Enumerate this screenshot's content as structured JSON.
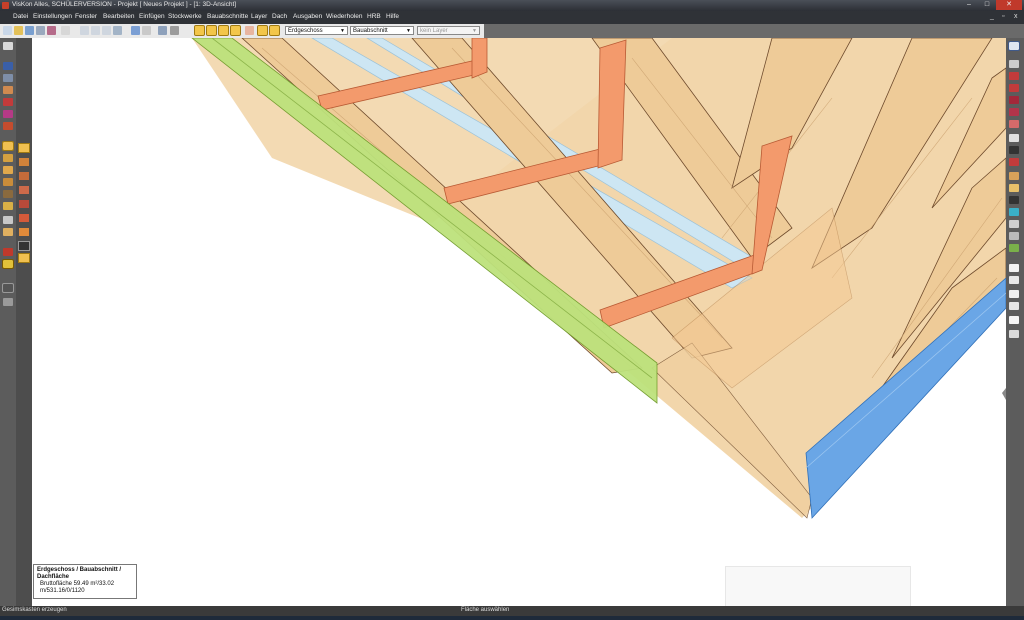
{
  "window": {
    "title": "VisKon Alles, SCHÜLERVERSION - Projekt [ Neues Projekt ] - [1: 3D-Ansicht]",
    "controls": [
      "–",
      "□",
      "✕"
    ]
  },
  "menu": {
    "items": [
      "Datei",
      "Einstellungen",
      "Fenster",
      "Bearbeiten",
      "Einfügen",
      "Stockwerke",
      "Bauabschnitte",
      "Layer",
      "Dach",
      "Ausgaben",
      "Wiederholen",
      "HRB",
      "Hilfe"
    ],
    "mdi_controls": [
      "_",
      "▫",
      "x"
    ]
  },
  "toolbar": {
    "floor_select": "Erdgeschoss",
    "section_select": "Bauabschnitt",
    "layer_select": "kein Layer"
  },
  "info": {
    "heading": "Erdgeschoss / Bauabschnitt / Dachfläche",
    "line1": "Bruttofläche 59.49 m²/33.02",
    "line2": "m/531.16/0/1120"
  },
  "status": {
    "left": "Gesimskasten erzeugen",
    "center": "Fläche auswählen"
  },
  "colors": {
    "wood": "#f1d3a6",
    "rafter_edge": "#6e4a2c",
    "collar_tie": "#f39a6c",
    "eaves_green": "#bde27c",
    "eaves_blue": "#6aa6e6",
    "batten_blue": "#cde6f3"
  },
  "icons": {
    "left_toolbar": [
      "cursor-icon",
      "roof-icon",
      "stack-icon",
      "wall-icon",
      "window-icon",
      "door-icon",
      "stair-icon",
      "column-icon",
      "slab-icon",
      "beam-icon",
      "dimension-icon",
      "text-icon",
      "hatch-icon",
      "line-icon",
      "arc-icon",
      "delete-icon",
      "measure-icon"
    ],
    "right_toolbar": [
      "3d-view-icon",
      "layer-icon",
      "eye-icon",
      "render-icon",
      "camera-icon",
      "light-icon",
      "section-icon",
      "zoom-icon",
      "settings-icon"
    ]
  }
}
